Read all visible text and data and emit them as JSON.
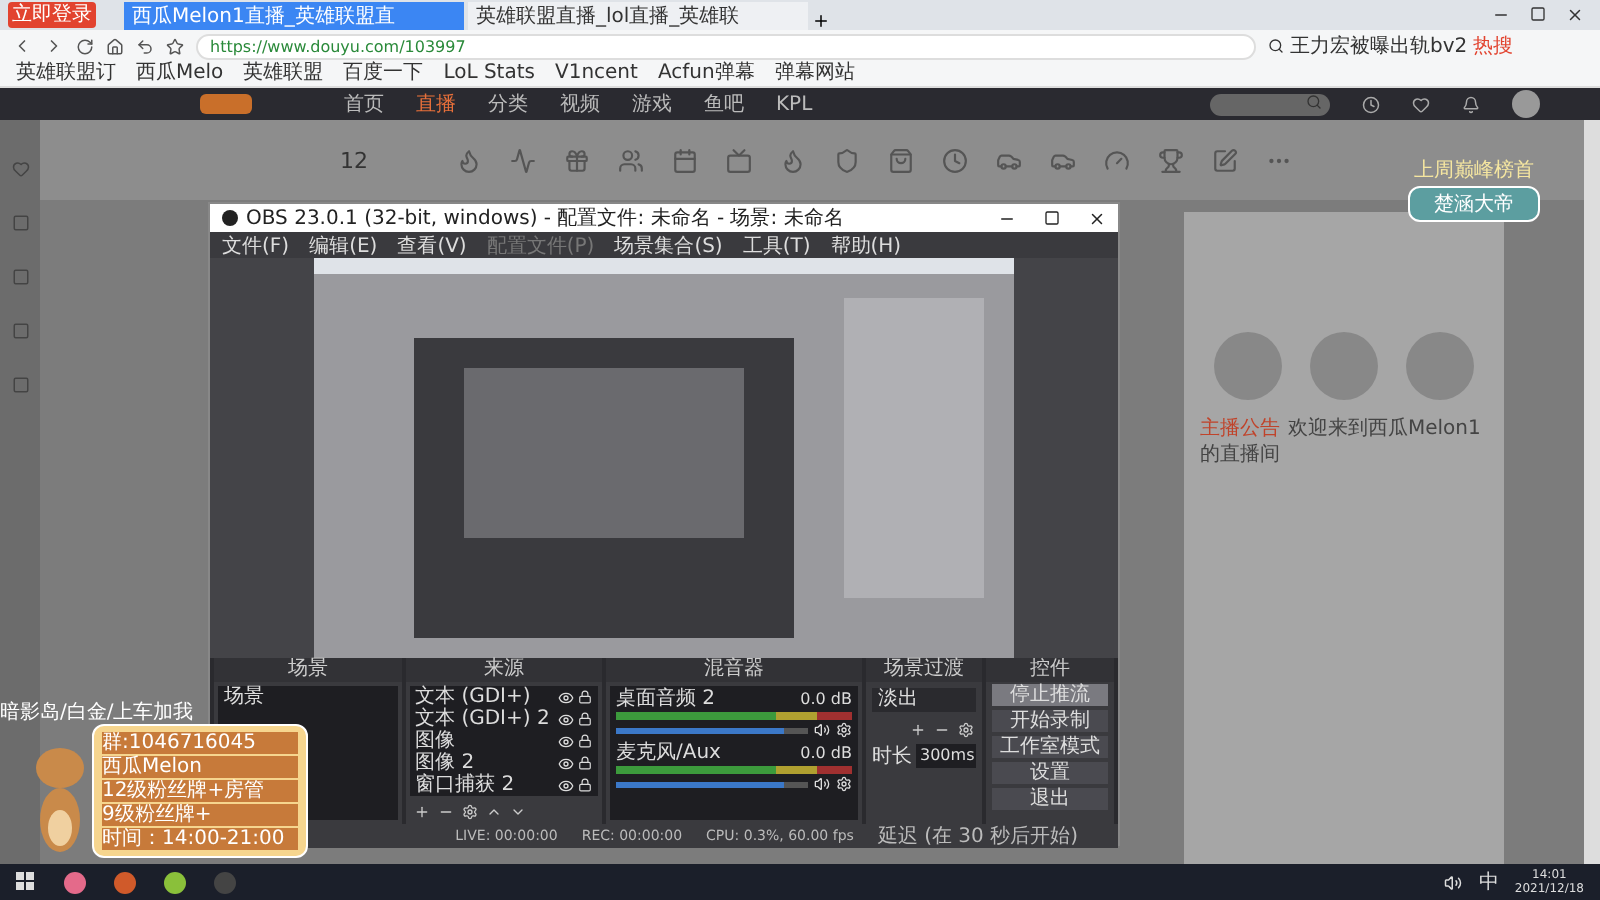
{
  "browser": {
    "login_badge": "立即登录",
    "tabs": [
      {
        "title": "西瓜Melon1直播_英雄联盟直",
        "selected": true
      },
      {
        "title": "英雄联盟直播_lol直播_英雄联",
        "selected": false
      }
    ],
    "url": "https://www.douyu.com/103997",
    "search": "王力宏被曝出轨bv2",
    "hot_badge": "热搜",
    "bookmarks": [
      "英雄联盟订",
      "西瓜Melo",
      "英雄联盟",
      "百度一下",
      "LoL Stats",
      "V1ncent",
      "Acfun弹幕",
      "弹幕网站"
    ]
  },
  "site": {
    "nav": [
      {
        "label": "首页",
        "selected": false
      },
      {
        "label": "直播",
        "selected": true
      },
      {
        "label": "分类",
        "selected": false
      },
      {
        "label": "视频",
        "selected": false
      },
      {
        "label": "游戏",
        "selected": false
      },
      {
        "label": "鱼吧",
        "selected": false
      },
      {
        "label": "KPL",
        "selected": false
      }
    ],
    "level": "12",
    "rank_title": "上周巅峰榜首",
    "rank_name": "楚涵大帝",
    "notice_label": "主播公告",
    "notice": "欢迎来到西瓜Melon1的直播间"
  },
  "obs": {
    "title": "OBS 23.0.1 (32-bit, windows) - 配置文件: 未命名 - 场景: 未命名",
    "menu": [
      {
        "label": "文件(F)",
        "disabled": false
      },
      {
        "label": "编辑(E)",
        "disabled": false
      },
      {
        "label": "查看(V)",
        "disabled": false
      },
      {
        "label": "配置文件(P)",
        "disabled": true
      },
      {
        "label": "场景集合(S)",
        "disabled": false
      },
      {
        "label": "工具(T)",
        "disabled": false
      },
      {
        "label": "帮助(H)",
        "disabled": false
      }
    ],
    "scenes": {
      "title": "场景",
      "items": [
        {
          "name": "场景",
          "selected": false
        }
      ]
    },
    "sources": {
      "title": "来源",
      "items": [
        {
          "name": "文本 (GDI+)",
          "visible": true
        },
        {
          "name": "文本 (GDI+) 2",
          "visible": true
        },
        {
          "name": "图像",
          "visible": true
        },
        {
          "name": "图像 2",
          "visible": true
        },
        {
          "name": "窗口捕获 2",
          "visible": true
        }
      ]
    },
    "mixer": {
      "title": "混音器",
      "channels": [
        {
          "name": "桌面音频 2",
          "reading": "0.0 dB",
          "level": 0.88
        },
        {
          "name": "麦克风/Aux",
          "reading": "0.0 dB",
          "level": 0.88
        }
      ]
    },
    "transitions": {
      "title": "场景过渡",
      "type": "淡出",
      "duration_label": "时长",
      "duration": "300ms"
    },
    "controls": {
      "title": "控件",
      "buttons": [
        {
          "label": "停止推流",
          "highlighted": true
        },
        {
          "label": "开始录制",
          "highlighted": false
        },
        {
          "label": "工作室模式",
          "highlighted": false
        },
        {
          "label": "设置",
          "highlighted": false
        },
        {
          "label": "退出",
          "highlighted": false
        }
      ]
    },
    "status": {
      "live": "LIVE: 00:00:00",
      "rec": "REC: 00:00:00",
      "cpu": "CPU: 0.3%, 60.00 fps",
      "delay": "延迟 (在 30 秒后开始)"
    }
  },
  "overlay": {
    "caption": "暗影岛/白金/上车加我",
    "lines": [
      "群:1046716045",
      "西瓜Melon",
      "12级粉丝牌+房管",
      "9级粉丝牌+",
      "时间：14:00-21:00"
    ]
  },
  "taskbar": {
    "ime": "中",
    "time": "14:01",
    "date": "2021/12/18"
  }
}
